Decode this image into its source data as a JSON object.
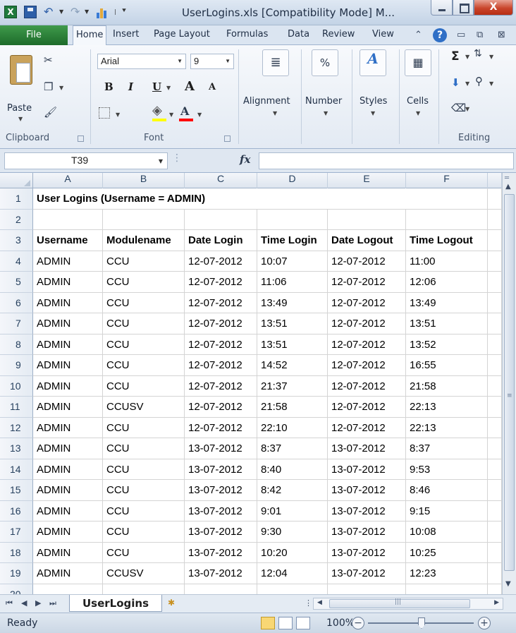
{
  "window": {
    "title": "UserLogins.xls  [Compatibility Mode]  M...",
    "logo_letter": "X",
    "close_glyph": "X"
  },
  "ribbon_tabs": {
    "file": "File",
    "items": [
      "Home",
      "Insert",
      "Page Layout",
      "Formulas",
      "Data",
      "Review",
      "View"
    ]
  },
  "ribbon": {
    "clipboard": {
      "label": "Clipboard",
      "paste": "Paste"
    },
    "font": {
      "label": "Font",
      "name": "Arial",
      "size": "9",
      "bold": "B",
      "italic": "I",
      "underline": "U",
      "grow": "A",
      "shrink": "A"
    },
    "alignment": {
      "label": "Alignment"
    },
    "number": {
      "label": "Number",
      "glyph": "%"
    },
    "styles": {
      "label": "Styles"
    },
    "cells": {
      "label": "Cells"
    },
    "editing": {
      "label": "Editing",
      "sum_glyph": "Σ"
    }
  },
  "formula_bar": {
    "name_box": "T39",
    "fx_label": "fx",
    "value": ""
  },
  "columns": [
    "A",
    "B",
    "C",
    "D",
    "E",
    "F"
  ],
  "rows": [
    {
      "num": "1",
      "bold": true,
      "cells": [
        "User Logins (Username = ADMIN)",
        "",
        "",
        "",
        "",
        ""
      ]
    },
    {
      "num": "2",
      "bold": false,
      "cells": [
        "",
        "",
        "",
        "",
        "",
        ""
      ]
    },
    {
      "num": "3",
      "bold": true,
      "cells": [
        "Username",
        "Modulename",
        "Date Login",
        "Time Login",
        "Date Logout",
        "Time Logout"
      ]
    },
    {
      "num": "4",
      "bold": false,
      "cells": [
        "ADMIN",
        "CCU",
        "12-07-2012",
        "10:07",
        "12-07-2012",
        "11:00"
      ]
    },
    {
      "num": "5",
      "bold": false,
      "cells": [
        "ADMIN",
        "CCU",
        "12-07-2012",
        "11:06",
        "12-07-2012",
        "12:06"
      ]
    },
    {
      "num": "6",
      "bold": false,
      "cells": [
        "ADMIN",
        "CCU",
        "12-07-2012",
        "13:49",
        "12-07-2012",
        "13:49"
      ]
    },
    {
      "num": "7",
      "bold": false,
      "cells": [
        "ADMIN",
        "CCU",
        "12-07-2012",
        "13:51",
        "12-07-2012",
        "13:51"
      ]
    },
    {
      "num": "8",
      "bold": false,
      "cells": [
        "ADMIN",
        "CCU",
        "12-07-2012",
        "13:51",
        "12-07-2012",
        "13:52"
      ]
    },
    {
      "num": "9",
      "bold": false,
      "cells": [
        "ADMIN",
        "CCU",
        "12-07-2012",
        "14:52",
        "12-07-2012",
        "16:55"
      ]
    },
    {
      "num": "10",
      "bold": false,
      "cells": [
        "ADMIN",
        "CCU",
        "12-07-2012",
        "21:37",
        "12-07-2012",
        "21:58"
      ]
    },
    {
      "num": "11",
      "bold": false,
      "cells": [
        "ADMIN",
        "CCUSV",
        "12-07-2012",
        "21:58",
        "12-07-2012",
        "22:13"
      ]
    },
    {
      "num": "12",
      "bold": false,
      "cells": [
        "ADMIN",
        "CCU",
        "12-07-2012",
        "22:10",
        "12-07-2012",
        "22:13"
      ]
    },
    {
      "num": "13",
      "bold": false,
      "cells": [
        "ADMIN",
        "CCU",
        "13-07-2012",
        "8:37",
        "13-07-2012",
        "8:37"
      ]
    },
    {
      "num": "14",
      "bold": false,
      "cells": [
        "ADMIN",
        "CCU",
        "13-07-2012",
        "8:40",
        "13-07-2012",
        "9:53"
      ]
    },
    {
      "num": "15",
      "bold": false,
      "cells": [
        "ADMIN",
        "CCU",
        "13-07-2012",
        "8:42",
        "13-07-2012",
        "8:46"
      ]
    },
    {
      "num": "16",
      "bold": false,
      "cells": [
        "ADMIN",
        "CCU",
        "13-07-2012",
        "9:01",
        "13-07-2012",
        "9:15"
      ]
    },
    {
      "num": "17",
      "bold": false,
      "cells": [
        "ADMIN",
        "CCU",
        "13-07-2012",
        "9:30",
        "13-07-2012",
        "10:08"
      ]
    },
    {
      "num": "18",
      "bold": false,
      "cells": [
        "ADMIN",
        "CCU",
        "13-07-2012",
        "10:20",
        "13-07-2012",
        "10:25"
      ]
    },
    {
      "num": "19",
      "bold": false,
      "cells": [
        "ADMIN",
        "CCUSV",
        "13-07-2012",
        "12:04",
        "13-07-2012",
        "12:23"
      ]
    },
    {
      "num": "20",
      "bold": false,
      "cells": [
        "",
        "",
        "",
        "",
        "",
        ""
      ]
    }
  ],
  "sheet_tabs": [
    "UserLogins"
  ],
  "status_bar": {
    "ready": "Ready",
    "zoom": "100%",
    "zoom_minus": "−",
    "zoom_plus": "+"
  },
  "colors": {
    "file_tab": "#1d6b2a",
    "close_button": "#c9452c",
    "font_color_underline": "#ff0000",
    "fill_color_underline": "#ffff00"
  },
  "icons": [
    "excel-logo-icon",
    "save-icon",
    "undo-icon",
    "redo-icon",
    "help-icon",
    "paste-icon",
    "cut-icon",
    "copy-icon",
    "format-painter-icon",
    "borders-icon",
    "fill-color-icon",
    "font-color-icon",
    "alignment-icon",
    "number-icon",
    "styles-icon",
    "cells-icon",
    "autosum-icon",
    "sort-filter-icon",
    "find-icon",
    "fill-icon",
    "clear-icon",
    "fx-icon",
    "insert-sheet-icon"
  ]
}
